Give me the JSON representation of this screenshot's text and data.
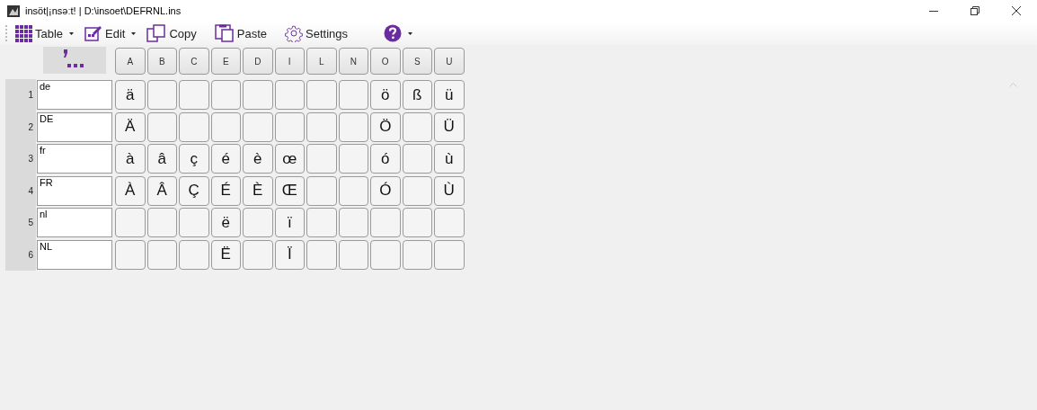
{
  "window": {
    "title": "insöt|¡nsəːt!  | D:\\insoet\\DEFRNL.ins"
  },
  "toolbar": [
    {
      "label": "Table",
      "dropdown": true
    },
    {
      "label": "Edit",
      "dropdown": true
    },
    {
      "label": "Copy",
      "dropdown": false
    },
    {
      "label": "Paste",
      "dropdown": false
    },
    {
      "label": "Settings",
      "dropdown": false
    },
    {
      "dropdown": true
    }
  ],
  "grid": {
    "columns": [
      "A",
      "B",
      "C",
      "E",
      "D",
      "I",
      "L",
      "N",
      "O",
      "S",
      "U"
    ],
    "rows": [
      {
        "number": "1",
        "name": "de",
        "cells": [
          "ä",
          null,
          null,
          null,
          null,
          null,
          null,
          null,
          "ö",
          "ß",
          "ü"
        ]
      },
      {
        "number": "2",
        "name": "DE",
        "cells": [
          "Ä",
          null,
          null,
          null,
          null,
          null,
          null,
          null,
          "Ö",
          null,
          "Ü"
        ]
      },
      {
        "number": "3",
        "name": "fr",
        "cells": [
          "à",
          "â",
          "ç",
          "é",
          "è",
          "œ",
          null,
          null,
          "ó",
          null,
          "ù"
        ]
      },
      {
        "number": "4",
        "name": "FR",
        "cells": [
          "À",
          "Â",
          "Ç",
          "É",
          "È",
          "Œ",
          null,
          null,
          "Ó",
          null,
          "Ù"
        ]
      },
      {
        "number": "5",
        "name": "nl",
        "cells": [
          null,
          null,
          null,
          "ë",
          null,
          "ï",
          null,
          null,
          null,
          null,
          null
        ]
      },
      {
        "number": "6",
        "name": "NL",
        "cells": [
          null,
          null,
          null,
          "Ë",
          null,
          "Ï",
          null,
          null,
          null,
          null,
          null
        ]
      }
    ]
  }
}
